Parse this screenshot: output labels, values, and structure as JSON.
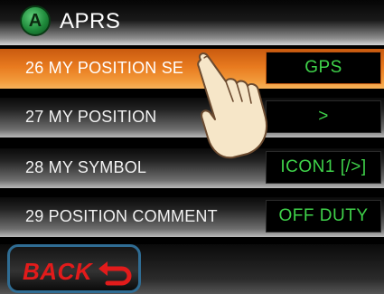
{
  "header": {
    "logo_letter": "A",
    "title": "APRS"
  },
  "menu": {
    "items": [
      {
        "label": "26 MY POSITION SE",
        "value": "GPS",
        "selected": true
      },
      {
        "label": "27 MY POSITION",
        "value": ">",
        "selected": false
      },
      {
        "label": "28 MY SYMBOL",
        "value": "ICON1 [/>]",
        "selected": false
      },
      {
        "label": "29 POSITION COMMENT",
        "value": "OFF DUTY",
        "selected": false
      }
    ]
  },
  "footer": {
    "back_label": "BACK"
  },
  "colors": {
    "selected_row": "#e87a1f",
    "value_text": "#3fd24a",
    "back_text": "#e21b1b",
    "back_border": "#2f6c93"
  },
  "icons": {
    "header": "aprs-logo-icon",
    "back": "return-arrow-icon",
    "overlay": "pointing-hand-icon"
  }
}
